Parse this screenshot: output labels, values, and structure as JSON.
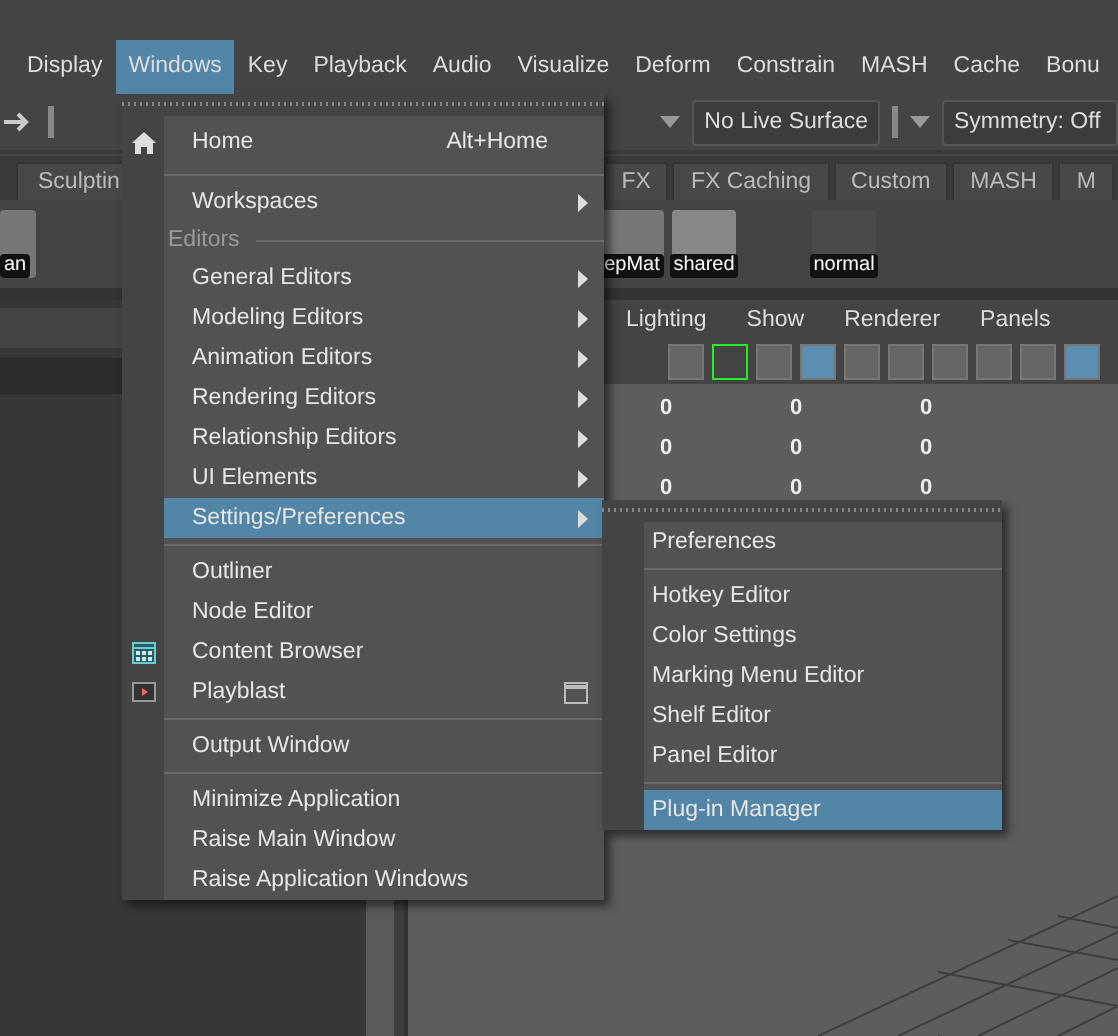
{
  "menu_bar": [
    {
      "label": "Display",
      "selected": false
    },
    {
      "label": "Windows",
      "selected": true
    },
    {
      "label": "Key",
      "selected": false
    },
    {
      "label": "Playback",
      "selected": false
    },
    {
      "label": "Audio",
      "selected": false
    },
    {
      "label": "Visualize",
      "selected": false
    },
    {
      "label": "Deform",
      "selected": false
    },
    {
      "label": "Constrain",
      "selected": false
    },
    {
      "label": "MASH",
      "selected": false
    },
    {
      "label": "Cache",
      "selected": false
    },
    {
      "label": "Bonu",
      "selected": false
    }
  ],
  "status_line": {
    "live_surface": "No Live Surface",
    "symmetry": "Symmetry: Off"
  },
  "shelf_tabs": [
    {
      "label": "Sculptin",
      "selected": false
    },
    {
      "label": "FX",
      "selected": false
    },
    {
      "label": "FX Caching",
      "selected": false
    },
    {
      "label": "Custom",
      "selected": false
    },
    {
      "label": "MASH",
      "selected": false
    },
    {
      "label": "M",
      "selected": false
    }
  ],
  "shelf_labels": [
    "an",
    "epMat",
    "shared",
    "normal"
  ],
  "viewport": {
    "menus": [
      "Lighting",
      "Show",
      "Renderer",
      "Panels"
    ],
    "rows": [
      [
        "0",
        "0",
        "0"
      ],
      [
        "0",
        "0",
        "0"
      ],
      [
        "0",
        "0",
        "0"
      ]
    ]
  },
  "windows_menu": [
    {
      "kind": "item",
      "label": "Home",
      "shortcut": "Alt+Home",
      "submenu": false,
      "option_box": false,
      "selected": false
    },
    {
      "kind": "separator"
    },
    {
      "kind": "item",
      "label": "Workspaces",
      "submenu": true,
      "option_box": false,
      "selected": false
    },
    {
      "kind": "section",
      "label": "Editors"
    },
    {
      "kind": "item",
      "label": "General Editors",
      "submenu": true,
      "option_box": false,
      "selected": false
    },
    {
      "kind": "item",
      "label": "Modeling Editors",
      "submenu": true,
      "option_box": false,
      "selected": false
    },
    {
      "kind": "item",
      "label": "Animation Editors",
      "submenu": true,
      "option_box": false,
      "selected": false
    },
    {
      "kind": "item",
      "label": "Rendering Editors",
      "submenu": true,
      "option_box": false,
      "selected": false
    },
    {
      "kind": "item",
      "label": "Relationship Editors",
      "submenu": true,
      "option_box": false,
      "selected": false
    },
    {
      "kind": "item",
      "label": "UI Elements",
      "submenu": true,
      "option_box": false,
      "selected": false
    },
    {
      "kind": "item",
      "label": "Settings/Preferences",
      "submenu": true,
      "option_box": false,
      "selected": true
    },
    {
      "kind": "separator"
    },
    {
      "kind": "item",
      "label": "Outliner",
      "submenu": false,
      "option_box": false,
      "selected": false
    },
    {
      "kind": "item",
      "label": "Node Editor",
      "submenu": false,
      "option_box": false,
      "selected": false
    },
    {
      "kind": "item",
      "label": "Content Browser",
      "submenu": false,
      "option_box": false,
      "selected": false
    },
    {
      "kind": "item",
      "label": "Playblast",
      "submenu": false,
      "option_box": true,
      "selected": false
    },
    {
      "kind": "separator"
    },
    {
      "kind": "item",
      "label": "Output Window",
      "submenu": false,
      "option_box": false,
      "selected": false
    },
    {
      "kind": "separator"
    },
    {
      "kind": "item",
      "label": "Minimize Application",
      "submenu": false,
      "option_box": false,
      "selected": false
    },
    {
      "kind": "item",
      "label": "Raise Main Window",
      "submenu": false,
      "option_box": false,
      "selected": false
    },
    {
      "kind": "item",
      "label": "Raise Application Windows",
      "submenu": false,
      "option_box": false,
      "selected": false
    }
  ],
  "settings_submenu": [
    {
      "kind": "item",
      "label": "Preferences",
      "selected": false
    },
    {
      "kind": "separator"
    },
    {
      "kind": "item",
      "label": "Hotkey Editor",
      "selected": false
    },
    {
      "kind": "item",
      "label": "Color Settings",
      "selected": false
    },
    {
      "kind": "item",
      "label": "Marking Menu Editor",
      "selected": false
    },
    {
      "kind": "item",
      "label": "Shelf Editor",
      "selected": false
    },
    {
      "kind": "item",
      "label": "Panel Editor",
      "selected": false
    },
    {
      "kind": "separator"
    },
    {
      "kind": "item",
      "label": "Plug-in Manager",
      "selected": true
    }
  ]
}
